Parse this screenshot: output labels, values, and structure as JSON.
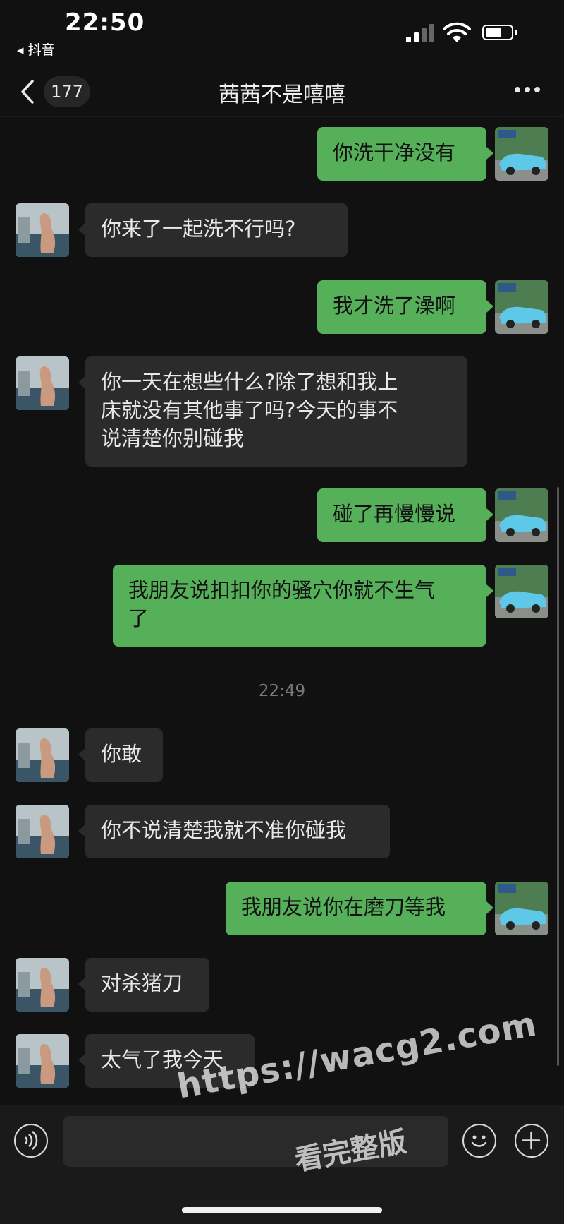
{
  "status_bar": {
    "time": "22:50",
    "back_app": "◂ 抖音"
  },
  "nav": {
    "badge": "177",
    "title": "茜茜不是嘻嘻"
  },
  "messages": [
    {
      "dir": "out",
      "text": "你洗干净没有"
    },
    {
      "dir": "in",
      "text": "你来了一起洗不行吗?"
    },
    {
      "dir": "out",
      "text": "我才洗了澡啊"
    },
    {
      "dir": "in",
      "lines": [
        "你一天在想些什么?除了想和我上",
        "床就没有其他事了吗?今天的事不",
        "说清楚你别碰我"
      ]
    },
    {
      "dir": "out",
      "text": "碰了再慢慢说"
    },
    {
      "dir": "out",
      "lines": [
        "我朋友说扣扣你的骚穴你就不生气",
        "了"
      ]
    },
    {
      "dir": "in",
      "text": "你敢"
    },
    {
      "dir": "in",
      "text": "你不说清楚我就不准你碰我"
    },
    {
      "dir": "out",
      "text": "我朋友说你在磨刀等我"
    },
    {
      "dir": "in",
      "text": "对杀猪刀"
    },
    {
      "dir": "in",
      "text": "太气了我今天"
    }
  ],
  "timestamp": "22:49",
  "watermark": {
    "url": "https://wacg2.com",
    "text": "看完整版"
  },
  "colors": {
    "out_bubble": "#56b05a",
    "in_bubble": "#2b2b2b",
    "background": "#111111"
  },
  "icons": [
    "signal-icon",
    "wifi-icon",
    "battery-icon",
    "back-chevron-icon",
    "more-icon",
    "voice-icon",
    "emoji-icon",
    "plus-icon"
  ]
}
